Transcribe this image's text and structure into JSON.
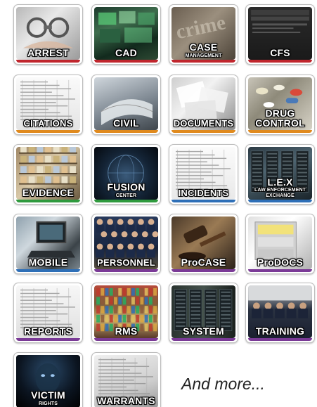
{
  "tiles": [
    {
      "id": "arrest",
      "label": "ARREST",
      "sub": "",
      "stripe": "#c0262d",
      "bg": "linear-gradient(135deg,#b8b8b8 0%,#e8e8e8 40%,#9a9a9a 100%)",
      "icon": "handcuffs-icon"
    },
    {
      "id": "cad",
      "label": "CAD",
      "sub": "",
      "stripe": "#c0262d",
      "bg": "linear-gradient(160deg,#1d3b2d 0%,#3e6d4d 35%,#122a1d 70%,#2e4a34 100%)",
      "icon": "monitors-icon"
    },
    {
      "id": "case-management",
      "label": "CASE",
      "sub": "MANAGEMENT",
      "stripe": "#c0262d",
      "bg": "linear-gradient(135deg,#6a5e50 0%,#9b8f7e 45%,#4c4338 100%)",
      "icon": "crime-scene-icon"
    },
    {
      "id": "cfs",
      "label": "CFS",
      "sub": "",
      "stripe": "#c0262d",
      "bg": "linear-gradient(180deg,#2b2b2b 0%,#1a1a1a 100%)",
      "icon": "screen-icon"
    },
    {
      "id": "citations",
      "label": "CITATIONS",
      "sub": "",
      "stripe": "#e08a1e",
      "bg": "linear-gradient(180deg,#fafafa 0%,#e4e4e4 100%)",
      "icon": "form-icon"
    },
    {
      "id": "civil",
      "label": "CIVIL",
      "sub": "",
      "stripe": "#e08a1e",
      "bg": "linear-gradient(160deg,#cfd6dc 0%,#7d8791 55%,#3e454b 100%)",
      "icon": "book-icon"
    },
    {
      "id": "documents",
      "label": "DOCUMENTS",
      "sub": "",
      "stripe": "#e08a1e",
      "bg": "linear-gradient(135deg,#cfcfcf 0%,#f2f2f2 40%,#8c8c8c 100%)",
      "icon": "papers-icon"
    },
    {
      "id": "drug-control",
      "label": "DRUG",
      "sub": "",
      "l2": "CONTROL",
      "stripe": "#e08a1e",
      "bg": "linear-gradient(135deg,#c8c4b8 0%,#8e8a7a 40%,#d6d2c6 100%)",
      "icon": "pills-icon"
    },
    {
      "id": "evidence",
      "label": "EVIDENCE",
      "sub": "",
      "stripe": "#2f9a3e",
      "bg": "linear-gradient(135deg,#a08866 0%,#d8c8a8 45%,#6b5a40 100%)",
      "icon": "shelves-icon"
    },
    {
      "id": "fusion-center",
      "label": "FUSION",
      "sub": "CENTER",
      "stripe": "#2f9a3e",
      "bg": "radial-gradient(circle at 50% 55%,#3a5a7a 0%,#142436 55%,#05090f 100%)",
      "icon": "globe-icon"
    },
    {
      "id": "incidents",
      "label": "INCIDENTS",
      "sub": "",
      "stripe": "#2e6fb7",
      "bg": "linear-gradient(180deg,#fbfbfb 0%,#e9e9e9 100%)",
      "icon": "report-form-icon"
    },
    {
      "id": "lex",
      "label": "L.E.X",
      "sub": "LAW ENFORCEMENT EXCHANGE",
      "stripe": "#2e6fb7",
      "bg": "linear-gradient(160deg,#2c3a44 0%,#4d6470 40%,#1a242a 100%)",
      "icon": "servers-icon"
    },
    {
      "id": "mobile",
      "label": "MOBILE",
      "sub": "",
      "stripe": "#2e6fb7",
      "bg": "linear-gradient(135deg,#8fa1ad 0%,#cfd8de 35%,#3b4348 75%,#7b878f 100%)",
      "icon": "laptop-icon"
    },
    {
      "id": "personnel",
      "label": "PERSONNEL",
      "sub": "",
      "stripe": "#7a3a96",
      "bg": "linear-gradient(180deg,#283a5c 0%,#18233a 60%,#5a5040 100%)",
      "icon": "officers-icon"
    },
    {
      "id": "procase",
      "label": "ProCASE",
      "sub": "",
      "stripe": "#7a3a96",
      "bg": "linear-gradient(135deg,#4b3a2a 0%,#9a7a54 45%,#2b2119 100%)",
      "icon": "gavel-icon"
    },
    {
      "id": "prodocs",
      "label": "ProDOCS",
      "sub": "",
      "stripe": "#7a3a96",
      "bg": "linear-gradient(135deg,#e0e0e0 0%,#ffffff 40%,#b0b0b0 100%)",
      "icon": "file-drawer-icon"
    },
    {
      "id": "reports",
      "label": "REPORTS",
      "sub": "",
      "stripe": "#7a3a96",
      "bg": "linear-gradient(180deg,#f7f7f7 0%,#e0e0e0 100%)",
      "icon": "text-page-icon"
    },
    {
      "id": "rms",
      "label": "RMS",
      "sub": "",
      "stripe": "#7a3a96",
      "bg": "linear-gradient(180deg,#b64a3a 0%,#7c5a3a 35%,#c8b070 65%,#5a3a2a 100%)",
      "icon": "folders-icon"
    },
    {
      "id": "system",
      "label": "SYSTEM",
      "sub": "",
      "stripe": "#7a3a96",
      "bg": "linear-gradient(90deg,#2a3430 0%,#45524c 50%,#1a201d 100%)",
      "icon": "server-racks-icon"
    },
    {
      "id": "training",
      "label": "TRAINING",
      "sub": "",
      "stripe": "#7a3a96",
      "bg": "linear-gradient(180deg,#cfd2d4 0%,#2b3342 45%,#1a2030 100%)",
      "icon": "classroom-icon"
    },
    {
      "id": "victim-rights",
      "label": "VICTIM",
      "sub": "RIGHTS",
      "stripe": "#7a3a96",
      "bg": "radial-gradient(circle at 50% 30%,#2a4a6a 0%,#0b1420 60%,#000 100%)",
      "icon": "face-icon"
    },
    {
      "id": "warrants",
      "label": "WARRANTS",
      "sub": "",
      "stripe": "#7a3a96",
      "bg": "linear-gradient(160deg,#f0f0f0 0%,#cfcfcf 60%,#9a9a9a 100%)",
      "icon": "warrant-doc-icon"
    }
  ],
  "more_text": "And more..."
}
